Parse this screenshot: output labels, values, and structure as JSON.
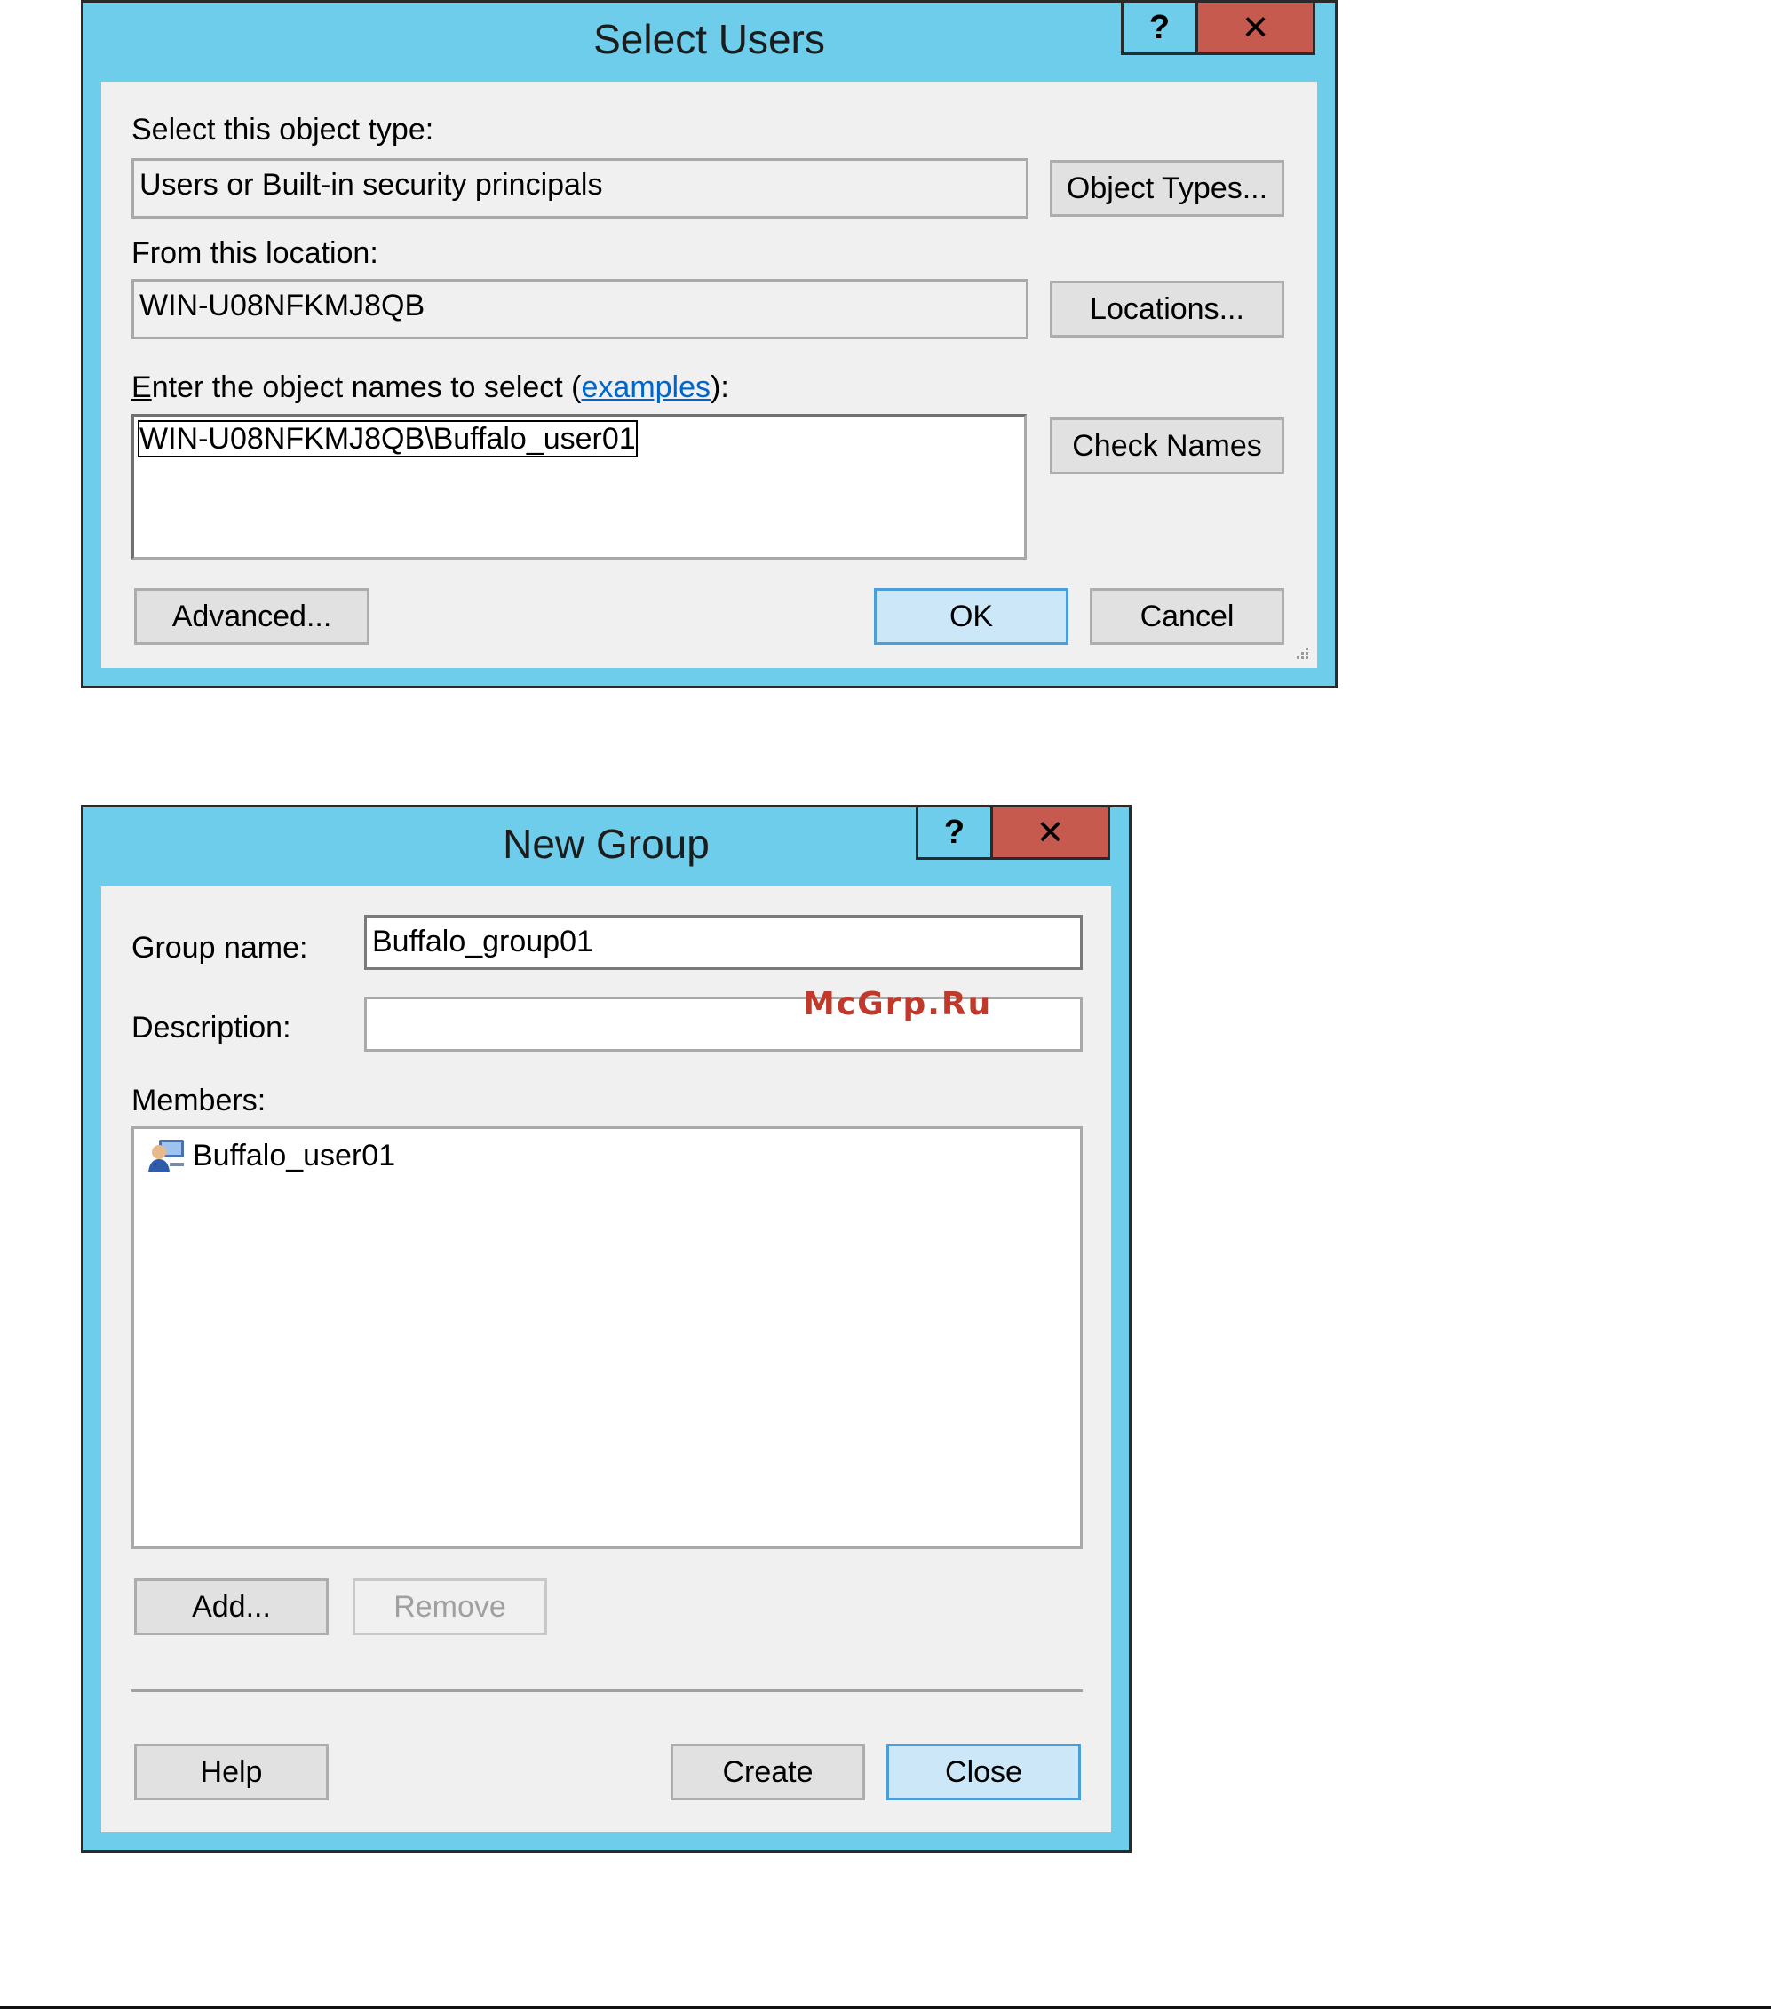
{
  "select_users": {
    "title": "Select Users",
    "help_glyph": "?",
    "close_glyph": "✕",
    "object_type_label": "Select this object type:",
    "object_type_value": "Users or Built-in security principals",
    "object_types_button": "Object Types...",
    "location_label": "From this location:",
    "location_value": "WIN-U08NFKMJ8QB",
    "locations_button": "Locations...",
    "names_label_first": "E",
    "names_label_rest": "nter the object names to select (",
    "names_label_link": "examples",
    "names_label_end": "):",
    "names_value": "WIN-U08NFKMJ8QB\\Buffalo_user01",
    "check_names_button": "Check Names",
    "advanced_button": "Advanced...",
    "ok_button": "OK",
    "cancel_button": "Cancel"
  },
  "new_group": {
    "title": "New Group",
    "help_glyph": "?",
    "close_glyph": "✕",
    "group_name_label": "Group name:",
    "group_name_value": "Buffalo_group01",
    "description_label": "Description:",
    "description_value": "",
    "members_label": "Members:",
    "members": [
      {
        "name": "Buffalo_user01",
        "icon": "user-icon"
      }
    ],
    "add_button": "Add...",
    "remove_button": "Remove",
    "help_button": "Help",
    "create_button": "Create",
    "close_button": "Close"
  },
  "watermark": "McGrp.Ru",
  "colors": {
    "title_bar": "#6dcdea",
    "close_button": "#c75a4f",
    "client_bg": "#f0f0f0",
    "link": "#0066cc",
    "watermark": "#c0392b"
  }
}
